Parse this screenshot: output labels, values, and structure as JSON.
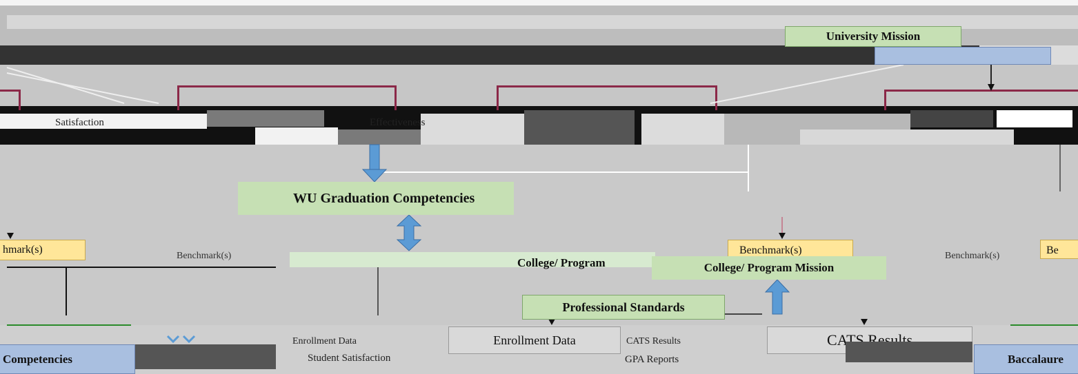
{
  "nodes": {
    "university_mission": "University Mission",
    "satisfaction": "Satisfaction",
    "effectiveness": "Effectiveness",
    "wu_graduation_competencies": "WU Graduation Competencies",
    "college_program": "College/ Program",
    "college_program_mission": "College/ Program Mission",
    "professional_standards": "Professional Standards",
    "benchmark_left": "hmark(s)",
    "benchmark_mid_left": "Benchmark(s)",
    "benchmark_mid_right": "Benchmark(s)",
    "benchmark_right": "Benchmark(s)",
    "benchmark_far_right": "Be",
    "enrollment_data": "Enrollment Data",
    "enrollment_data_small": "Enrollment Data",
    "student_satisfaction": "Student Satisfaction",
    "cats_results": "CATS Results",
    "cats_results_small": "CATS Results",
    "gpa_reports": "GPA Reports",
    "competencies_left": "Competencies",
    "baccalaureate_right": "Baccalaure"
  },
  "colors": {
    "green_box": "#c6e0b4",
    "yellow_box": "#ffe699",
    "blue_box": "#a9bfe0",
    "maroon_border": "#8b2848",
    "blue_arrow": "#5b9bd5"
  }
}
